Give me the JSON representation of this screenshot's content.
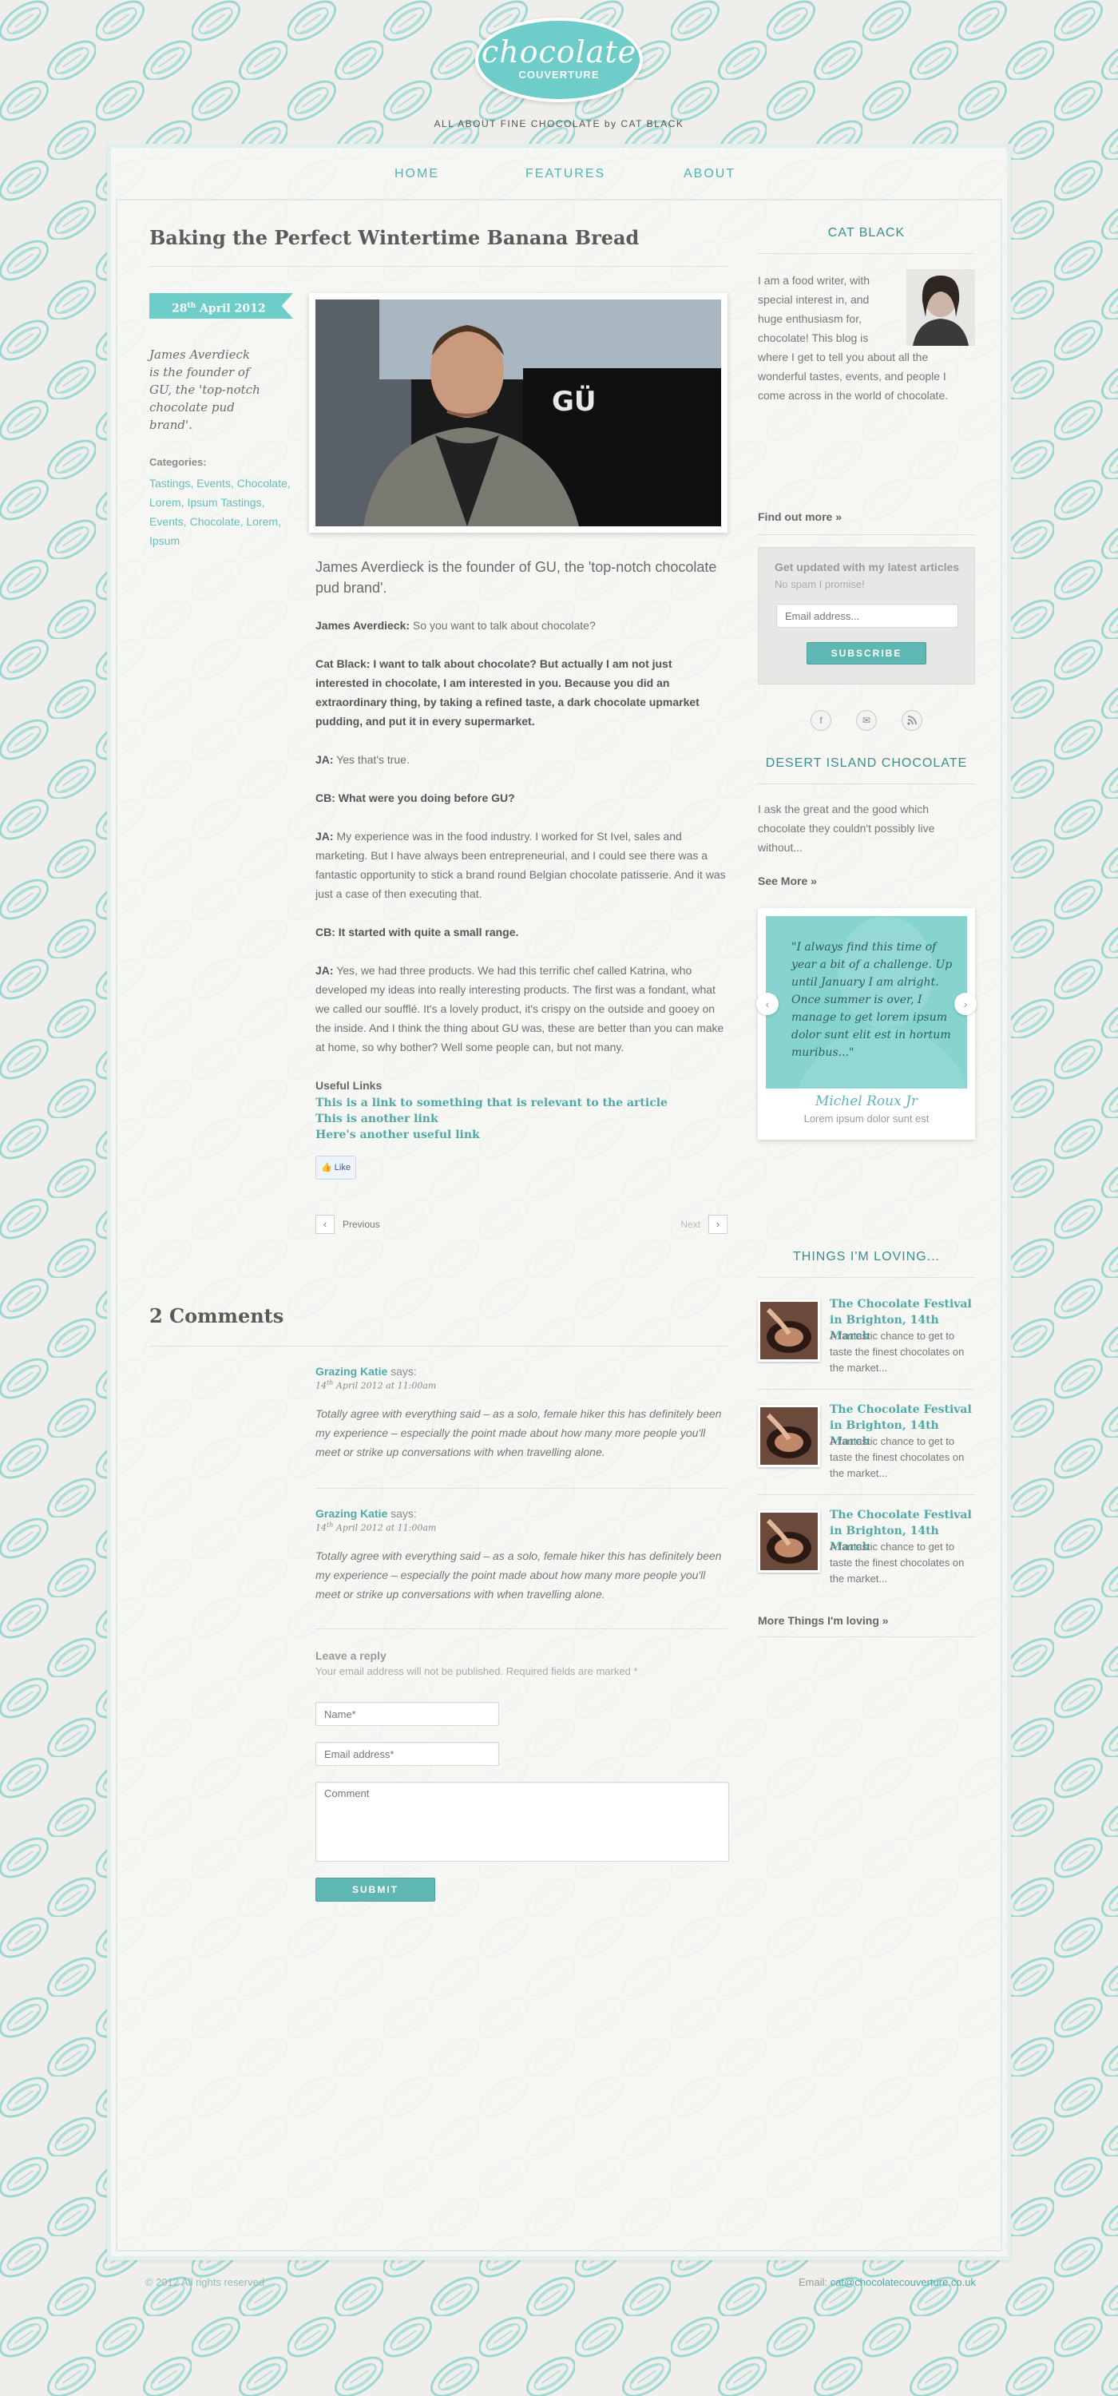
{
  "header": {
    "logo_word": "chocolate",
    "logo_sub": "COUVERTURE",
    "tagline": "ALL ABOUT FINE CHOCOLATE by CAT BLACK"
  },
  "nav": {
    "items": [
      "HOME",
      "FEATURES",
      "ABOUT"
    ]
  },
  "post": {
    "title": "Baking the Perfect Wintertime Banana Bread",
    "date_day": "28",
    "date_suffix": "th",
    "date_rest": " April 2012",
    "side_quote": "James Averdieck is the founder of GU, the 'top-notch chocolate pud brand'.",
    "categories_label": "Categories:",
    "categories": "Tastings, Events, Chocolate, Lorem, Ipsum Tastings, Events, Chocolate, Lorem, Ipsum",
    "photo_brand": "GÜ",
    "lead": "James Averdieck is the founder of GU, the 'top-notch chocolate pud brand'.",
    "paragraphs": [
      {
        "speaker": "James Averdieck:",
        "text": " So you want to talk about chocolate?",
        "bold_all": false
      },
      {
        "speaker": "Cat Black:",
        "text": " I want to talk about chocolate? But actually I am not just interested in chocolate, I am interested in you. Because you did an extraordinary thing, by taking a refined taste, a dark chocolate upmarket pudding, and put it in every supermarket.",
        "bold_all": true
      },
      {
        "speaker": " JA:",
        "text": " Yes that's true.",
        "bold_all": false
      },
      {
        "speaker": "CB:",
        "text": " What were you doing before GU?",
        "bold_all": true
      },
      {
        "speaker": "JA:",
        "text": " My experience was in the food industry. I worked for St Ivel, sales and marketing. But I have always been entrepreneurial, and I could see there was a fantastic opportunity to stick a brand round Belgian chocolate patisserie. And it was just a case of then executing that.",
        "bold_all": false
      },
      {
        "speaker": "CB:",
        "text": " It started with quite a small range.",
        "bold_all": true
      },
      {
        "speaker": "JA:",
        "text": " Yes, we had three products. We had this terrific chef called Katrina, who developed my ideas into really interesting products. The first was a fondant, what we called our soufflé. It's a lovely product, it's crispy on the outside and gooey on the inside. And I think the thing about GU was, these are better than you can make at home, so why bother? Well some people can, but not many.",
        "bold_all": false
      }
    ],
    "useful_title": "Useful Links",
    "useful_links": [
      "This is a link to something that is relevant to the article",
      "This is another link",
      "Here's another useful link"
    ],
    "like_label": "Like",
    "prev_label": "Previous",
    "next_label": "Next"
  },
  "comments": {
    "title": "2 Comments",
    "items": [
      {
        "author": "Grazing Katie",
        "says": " says:",
        "date_day": "14",
        "date_suffix": "th",
        "date_rest": " April 2012 at 11:00am",
        "body": "Totally agree with everything said – as a solo, female hiker this has definitely been my experience – especially the point made about how many more people you'll meet or strike up conversations with when travelling alone."
      },
      {
        "author": "Grazing Katie",
        "says": " says:",
        "date_day": "14",
        "date_suffix": "th",
        "date_rest": " April 2012 at 11:00am",
        "body": "Totally agree with everything said – as a solo, female hiker this has definitely been my experience – especially the point made about how many more people you'll meet or strike up conversations with when travelling alone."
      }
    ]
  },
  "reply": {
    "title": "Leave a reply",
    "note": "Your email address will not be published. Required fields are marked *",
    "name_placeholder": "Name*",
    "email_placeholder": "Email address*",
    "comment_placeholder": "Comment",
    "submit_label": "SUBMIT"
  },
  "sidebar": {
    "about": {
      "title": "CAT BLACK",
      "text": "I am a food writer, with special interest in, and huge enthusiasm for, chocolate! This blog is where I get to tell you about all the wonderful tastes, events, and people I come across in the world of chocolate.",
      "more": "Find out more »"
    },
    "newsletter": {
      "title": "Get updated with my latest articles",
      "note": "No spam I promise!",
      "placeholder": "Email address...",
      "button": "SUBSCRIBE"
    },
    "social_icons": [
      "facebook-icon",
      "email-icon",
      "rss-icon"
    ],
    "desert": {
      "title": "DESERT ISLAND CHOCOLATE",
      "text": "I ask the great and the good which chocolate they couldn't possibly live without...",
      "more": "See More »",
      "quote": "\"I always find this time of year a bit of a challenge. Up until January I am alright. Once summer is over, I manage to get lorem ipsum dolor sunt elit est in hortum muribus...\"",
      "name": "Michel Roux Jr",
      "sub": "Lorem ipsum dolor sunt est"
    },
    "loving": {
      "title": "THINGS I'M LOVING...",
      "items": [
        {
          "title": "The Chocolate Festival in Brighton, 14th March",
          "desc": "A fantastic chance to get to taste the finest chocolates on the market..."
        },
        {
          "title": "The Chocolate Festival in Brighton, 14th March",
          "desc": "A fantastic chance to get to taste the finest chocolates on the market..."
        },
        {
          "title": "The Chocolate Festival in Brighton, 14th March",
          "desc": "A fantastic chance to get to taste the finest chocolates on the market..."
        }
      ],
      "more": "More Things I'm loving »"
    }
  },
  "footer": {
    "copyright": "© 2012 All rights reserved",
    "email_label": "Email: ",
    "email": "cat@chocolatecouverture.co.uk"
  },
  "colors": {
    "accent": "#6fcdc9",
    "link": "#4fa9a6",
    "background": "#efeeea"
  }
}
